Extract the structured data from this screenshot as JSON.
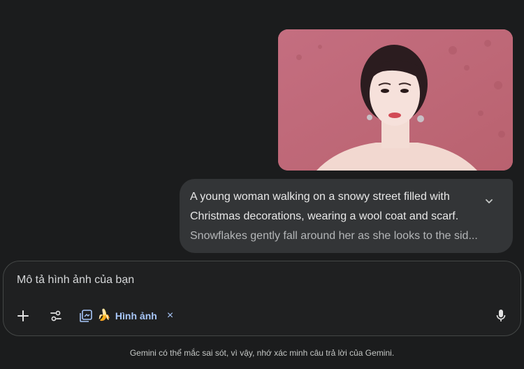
{
  "conversation": {
    "prompt_lines": [
      "A young woman walking on a snowy street filled with",
      "Christmas decorations, wearing a wool coat and scarf.",
      "Snowflakes gently fall around her as she looks to the sid..."
    ]
  },
  "composer": {
    "input_value": "Mô tả hình ảnh của bạn",
    "tool_chip": {
      "emoji": "🍌",
      "label": "Hình ảnh",
      "close": "×"
    }
  },
  "footer": {
    "disclaimer": "Gemini có thể mắc sai sót, vì vậy, nhớ xác minh câu trả lời của Gemini."
  },
  "icons": {
    "expand": "chevron-down-icon",
    "add": "plus-icon",
    "tools": "tune-icon",
    "library": "image-library-icon",
    "mic": "mic-icon"
  },
  "colors": {
    "background": "#1b1c1d",
    "bubble": "#333537",
    "accent": "#a8c7fa",
    "image_background": "#c4707f"
  }
}
